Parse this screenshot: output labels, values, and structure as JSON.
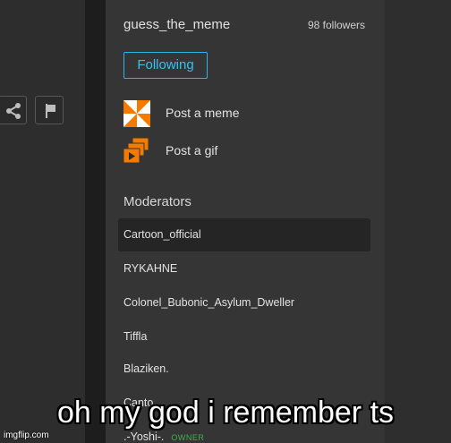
{
  "stream": {
    "name": "guess_the_meme",
    "followers": "98 followers",
    "follow_button": "Following"
  },
  "actions": {
    "post_meme": "Post a meme",
    "post_gif": "Post a gif"
  },
  "left_toolbar": {
    "share_icon": "share-icon",
    "flag_icon": "flag-icon"
  },
  "moderators": {
    "heading": "Moderators",
    "list": [
      {
        "name": "Cartoon_official"
      },
      {
        "name": "RYKAHNE"
      },
      {
        "name": "Colonel_Bubonic_Asylum_Dweller"
      },
      {
        "name": "Tiffla"
      },
      {
        "name": "Blaziken."
      },
      {
        "name": "Canto"
      },
      {
        "name": ".-Yoshi-.",
        "badge": "OWNER"
      }
    ]
  },
  "caption": "oh my god i remember ts",
  "watermark": "imgflip.com",
  "colors": {
    "accent": "#2ab5e6",
    "owner_badge": "#3fb14a",
    "panel": "#353535",
    "background": "#2e2e2e"
  }
}
